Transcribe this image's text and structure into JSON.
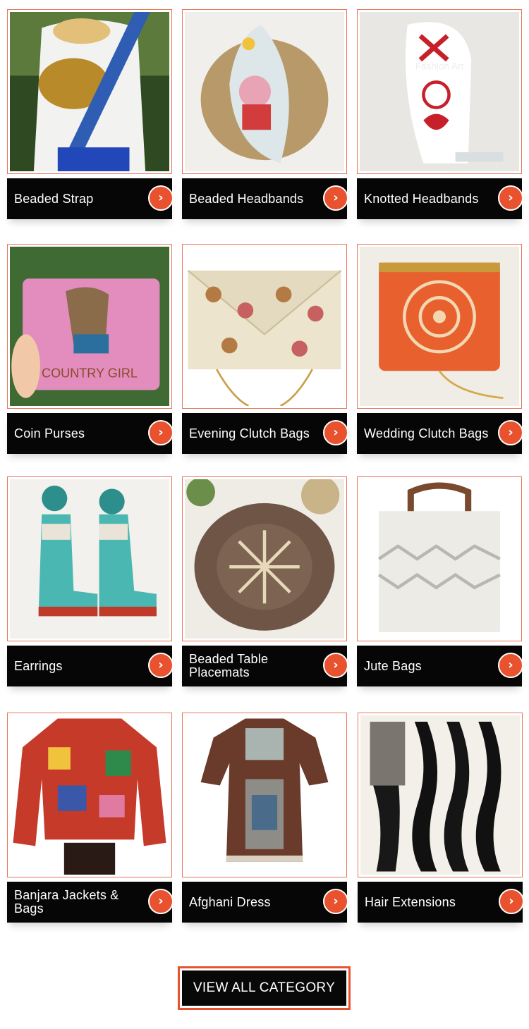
{
  "categories": [
    {
      "label": "Beaded Strap",
      "icon": "chevron-right-icon"
    },
    {
      "label": "Beaded Headbands",
      "icon": "chevron-right-icon"
    },
    {
      "label": "Knotted Headbands",
      "icon": "chevron-right-icon",
      "image_text": "Fashion Art"
    },
    {
      "label": "Coin Purses",
      "icon": "chevron-right-icon",
      "image_text": "COUNTRY GIRL"
    },
    {
      "label": "Evening Clutch Bags",
      "icon": "chevron-right-icon"
    },
    {
      "label": "Wedding Clutch Bags",
      "icon": "chevron-right-icon"
    },
    {
      "label": "Earrings",
      "icon": "chevron-right-icon"
    },
    {
      "label": "Beaded Table Placemats",
      "icon": "chevron-right-icon"
    },
    {
      "label": "Jute Bags",
      "icon": "chevron-right-icon"
    },
    {
      "label": "Banjara Jackets & Bags",
      "icon": "chevron-right-icon"
    },
    {
      "label": "Afghani Dress",
      "icon": "chevron-right-icon"
    },
    {
      "label": "Hair Extensions",
      "icon": "chevron-right-icon"
    }
  ],
  "view_all": {
    "label": "VIEW ALL CATEGORY"
  },
  "colors": {
    "accent": "#e8522e",
    "border": "#e8765a",
    "bar": "#060606",
    "text": "#ffffff"
  },
  "arrow_glyph": "›"
}
